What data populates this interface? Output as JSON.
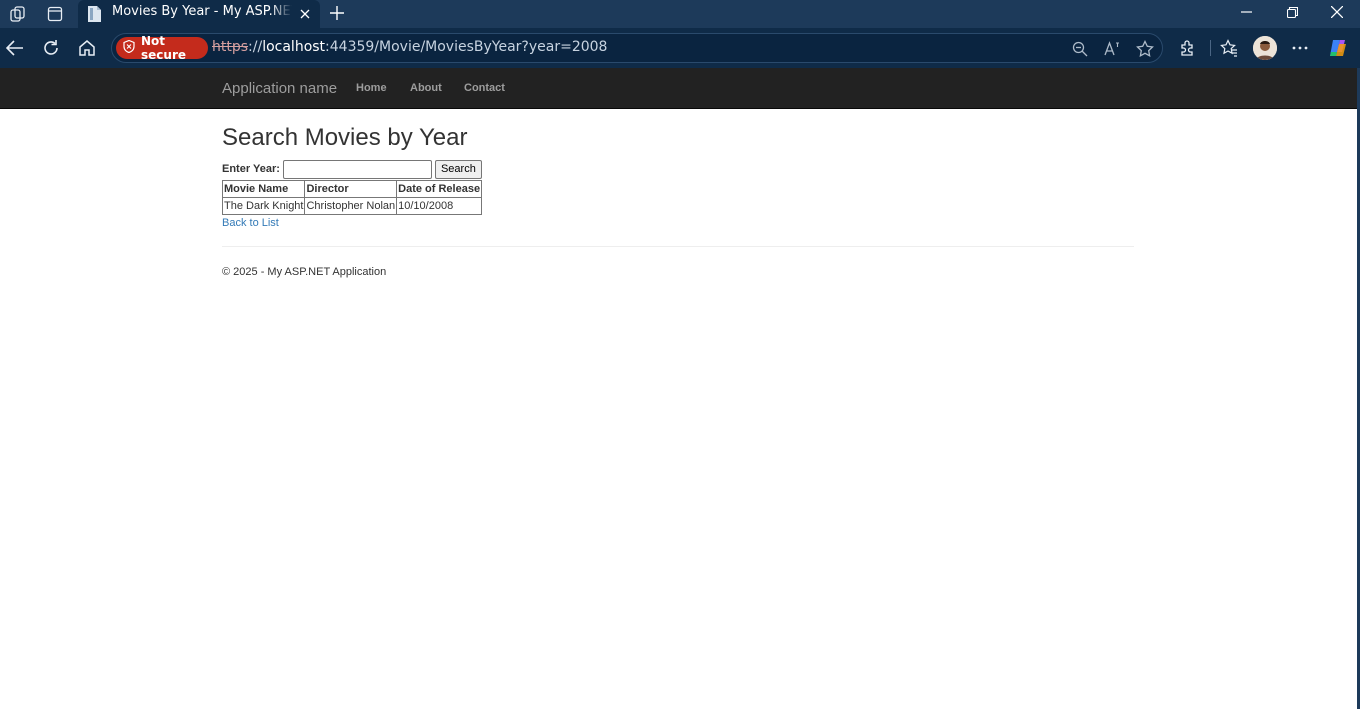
{
  "browser": {
    "tab_title": "Movies By Year - My ASP.NET Application",
    "security_label": "Not secure",
    "url_scheme": "https",
    "url_sep": "://",
    "url_host": "localhost",
    "url_rest": ":44359/Movie/MoviesByYear?year=2008"
  },
  "navbar": {
    "brand": "Application name",
    "links": [
      "Home",
      "About",
      "Contact"
    ]
  },
  "main": {
    "heading": "Search Movies by Year",
    "year_label": "Enter Year:",
    "year_value": "",
    "search_button": "Search",
    "table": {
      "headers": [
        "Movie Name",
        "Director",
        "Date of Release"
      ],
      "rows": [
        [
          "The Dark Knight",
          "Christopher Nolan",
          "10/10/2008"
        ]
      ]
    },
    "back_link": "Back to List"
  },
  "footer": {
    "text": "© 2025 - My ASP.NET Application"
  },
  "colors": {
    "navbar_bg": "#222222",
    "link": "#337ab7",
    "not_secure_bg": "#c42b1c",
    "browser_chrome": "#0f2b48"
  }
}
